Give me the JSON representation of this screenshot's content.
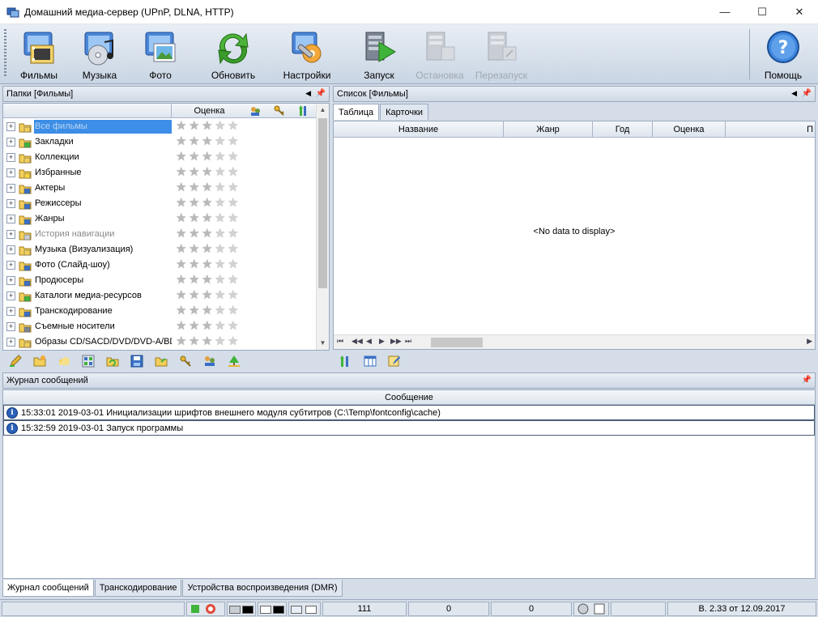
{
  "window": {
    "title": "Домашний медиа-сервер (UPnP, DLNA, HTTP)",
    "minimize": "—",
    "maximize": "☐",
    "close": "✕"
  },
  "toolbar": {
    "movies": "Фильмы",
    "music": "Музыка",
    "photo": "Фото",
    "refresh": "Обновить",
    "settings": "Настройки",
    "start": "Запуск",
    "stop": "Остановка",
    "restart": "Перезапуск",
    "help": "Помощь"
  },
  "folders_panel": {
    "title": "Папки [Фильмы]",
    "rating_header": "Оценка",
    "items": [
      {
        "label": "Все фильмы",
        "state": "selected"
      },
      {
        "label": "Закладки",
        "state": "normal"
      },
      {
        "label": "Коллекции",
        "state": "normal"
      },
      {
        "label": "Избранные",
        "state": "normal"
      },
      {
        "label": "Актеры",
        "state": "normal"
      },
      {
        "label": "Режиссеры",
        "state": "normal"
      },
      {
        "label": "Жанры",
        "state": "normal"
      },
      {
        "label": "История навигации",
        "state": "gray"
      },
      {
        "label": "Музыка (Визуализация)",
        "state": "normal"
      },
      {
        "label": "Фото (Слайд-шоу)",
        "state": "normal"
      },
      {
        "label": "Продюсеры",
        "state": "normal"
      },
      {
        "label": "Каталоги медиа-ресурсов",
        "state": "normal"
      },
      {
        "label": "Транскодирование",
        "state": "normal"
      },
      {
        "label": "Съемные носители",
        "state": "normal"
      },
      {
        "label": "Образы CD/SACD/DVD/DVD-A/BD",
        "state": "normal"
      }
    ]
  },
  "list_panel": {
    "title": "Список [Фильмы]",
    "tabs": [
      "Таблица",
      "Карточки"
    ],
    "columns": [
      "Название",
      "Жанр",
      "Год",
      "Оценка",
      "П"
    ],
    "empty_text": "<No data to display>"
  },
  "log_panel": {
    "title": "Журнал сообщений",
    "column": "Сообщение",
    "rows": [
      "15:33:01 2019-03-01 Инициализации шрифтов внешнего модуля субтитров (C:\\Temp\\fontconfig\\cache)",
      "15:32:59 2019-03-01 Запуск программы"
    ]
  },
  "bottom_tabs": [
    "Журнал сообщений",
    "Транскодирование",
    "Устройства воспроизведения (DMR)"
  ],
  "statusbar": {
    "count1": "111",
    "count2": "0",
    "count3": "0",
    "version": "В. 2.33 от 12.09.2017"
  },
  "colors": {
    "selection": "#3d8ee6",
    "panel_bg": "#d4dde8",
    "border": "#9aa9bd"
  }
}
